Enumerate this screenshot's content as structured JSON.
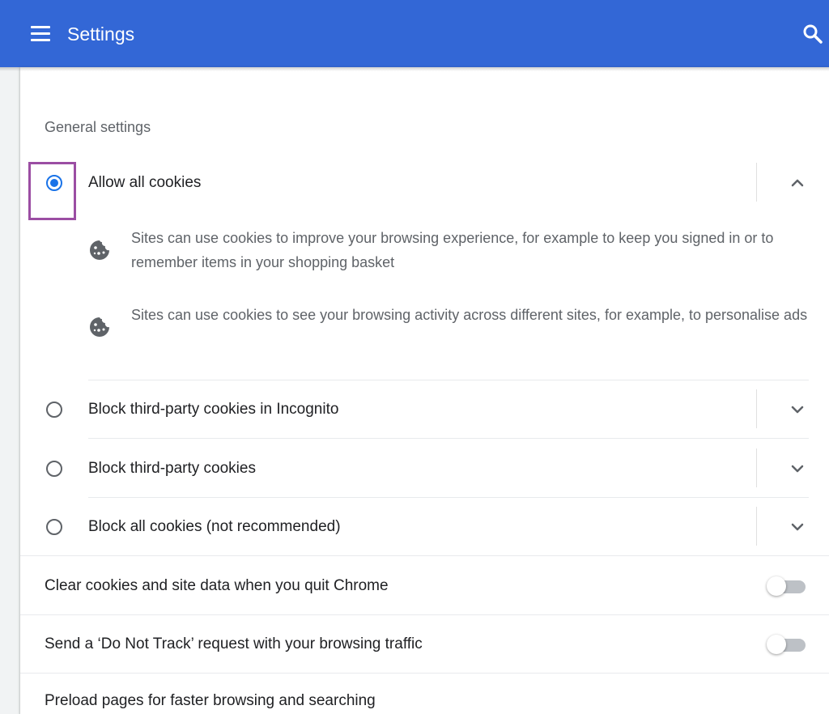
{
  "toolbar": {
    "title": "Settings",
    "menu_icon": "hamburger-menu-icon",
    "search_icon": "search-icon",
    "background": "#3367d6"
  },
  "section": {
    "title": "General settings"
  },
  "cookie_options": [
    {
      "label": "Allow all cookies",
      "selected": true,
      "expanded": true,
      "details": [
        {
          "icon": "cookie-icon",
          "text": "Sites can use cookies to improve your browsing experience, for example to keep you signed in or to remember items in your shopping basket"
        },
        {
          "icon": "cookie-icon",
          "text": "Sites can use cookies to see your browsing activity across different sites, for example, to personalise ads"
        }
      ]
    },
    {
      "label": "Block third-party cookies in Incognito",
      "selected": false,
      "expanded": false
    },
    {
      "label": "Block third-party cookies",
      "selected": false,
      "expanded": false
    },
    {
      "label": "Block all cookies (not recommended)",
      "selected": false,
      "expanded": false
    }
  ],
  "toggles": [
    {
      "label": "Clear cookies and site data when you quit Chrome",
      "on": false
    },
    {
      "label": "Send a ‘Do Not Track’ request with your browsing traffic",
      "on": false
    },
    {
      "label": "Preload pages for faster browsing and searching",
      "on": false
    }
  ],
  "colors": {
    "accent": "#1a73e8",
    "highlight": "#9b4ea3"
  }
}
